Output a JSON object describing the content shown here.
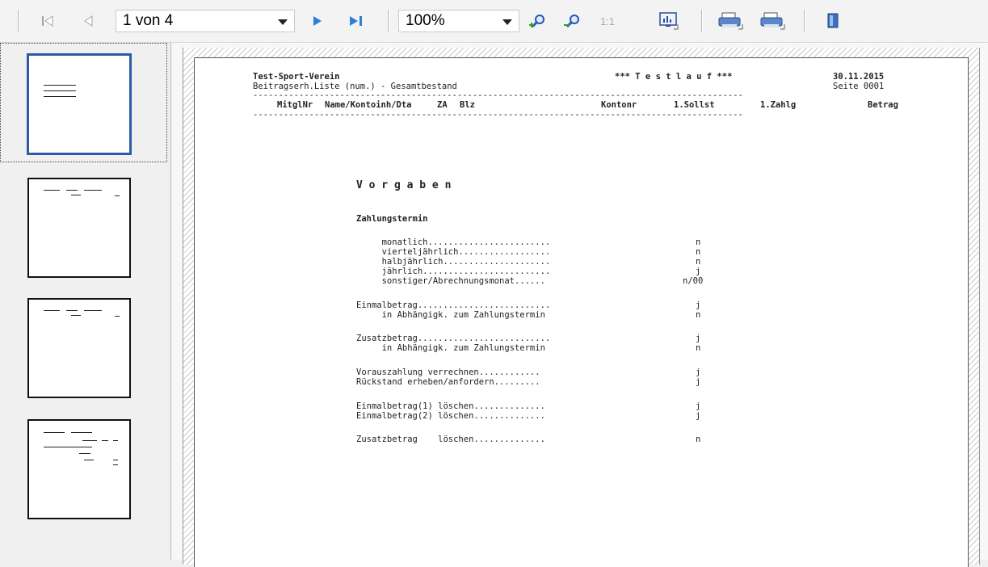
{
  "toolbar": {
    "page_selector": "1 von 4",
    "zoom": "100%",
    "one_to_one_label": "1:1",
    "icons": [
      "first-page-icon",
      "previous-page-icon",
      "next-page-icon",
      "last-page-icon",
      "zoom-in-icon",
      "zoom-out-icon",
      "actual-size-icon",
      "chart-icon",
      "print-icon",
      "print-setup-icon",
      "close-book-icon"
    ]
  },
  "thumbnails": {
    "count": 4,
    "selected": 1
  },
  "report": {
    "org": "Test-Sport-Verein",
    "run_marker": "*** T e s t l a u f ***",
    "date": "30.11.2015",
    "list_title": "Beitragserh.Liste (num.) - Gesamtbestand",
    "page_label": "Seite 0001",
    "rule": "------------------------------------------------------------------------------------------------",
    "columns": {
      "mitglnr": "MitglNr",
      "name": "Name/Kontoinh/Dta",
      "za": "ZA",
      "blz": "Blz",
      "konto": "Kontonr",
      "soll": "1.Sollst",
      "zahl": "1.Zahlg",
      "betrag": "Betrag"
    },
    "vorgaben_title": "V o r g a b e n",
    "zahlungstermin": "Zahlungstermin",
    "lines": [
      {
        "label": "     monatlich........................",
        "value": "n"
      },
      {
        "label": "     vierteljährlich..................",
        "value": "n"
      },
      {
        "label": "     halbjährlich.....................",
        "value": "n"
      },
      {
        "label": "     jährlich.........................",
        "value": "j"
      },
      {
        "label": "     sonstiger/Abrechnungsmonat......",
        "value": "n/00"
      },
      {
        "label": "Einmalbetrag..........................",
        "value": "j"
      },
      {
        "label": "     in Abhängigk. zum Zahlungstermin",
        "value": "n"
      },
      {
        "label": "Zusatzbetrag..........................",
        "value": "j"
      },
      {
        "label": "     in Abhängigk. zum Zahlungstermin",
        "value": "n"
      },
      {
        "label": "Vorauszahlung verrechnen............",
        "value": "j"
      },
      {
        "label": "Rückstand erheben/anfordern.........",
        "value": "j"
      },
      {
        "label": "Einmalbetrag(1) löschen..............",
        "value": "j"
      },
      {
        "label": "Einmalbetrag(2) löschen..............",
        "value": "j"
      },
      {
        "label": "Zusatzbetrag    löschen..............",
        "value": "n"
      }
    ]
  }
}
